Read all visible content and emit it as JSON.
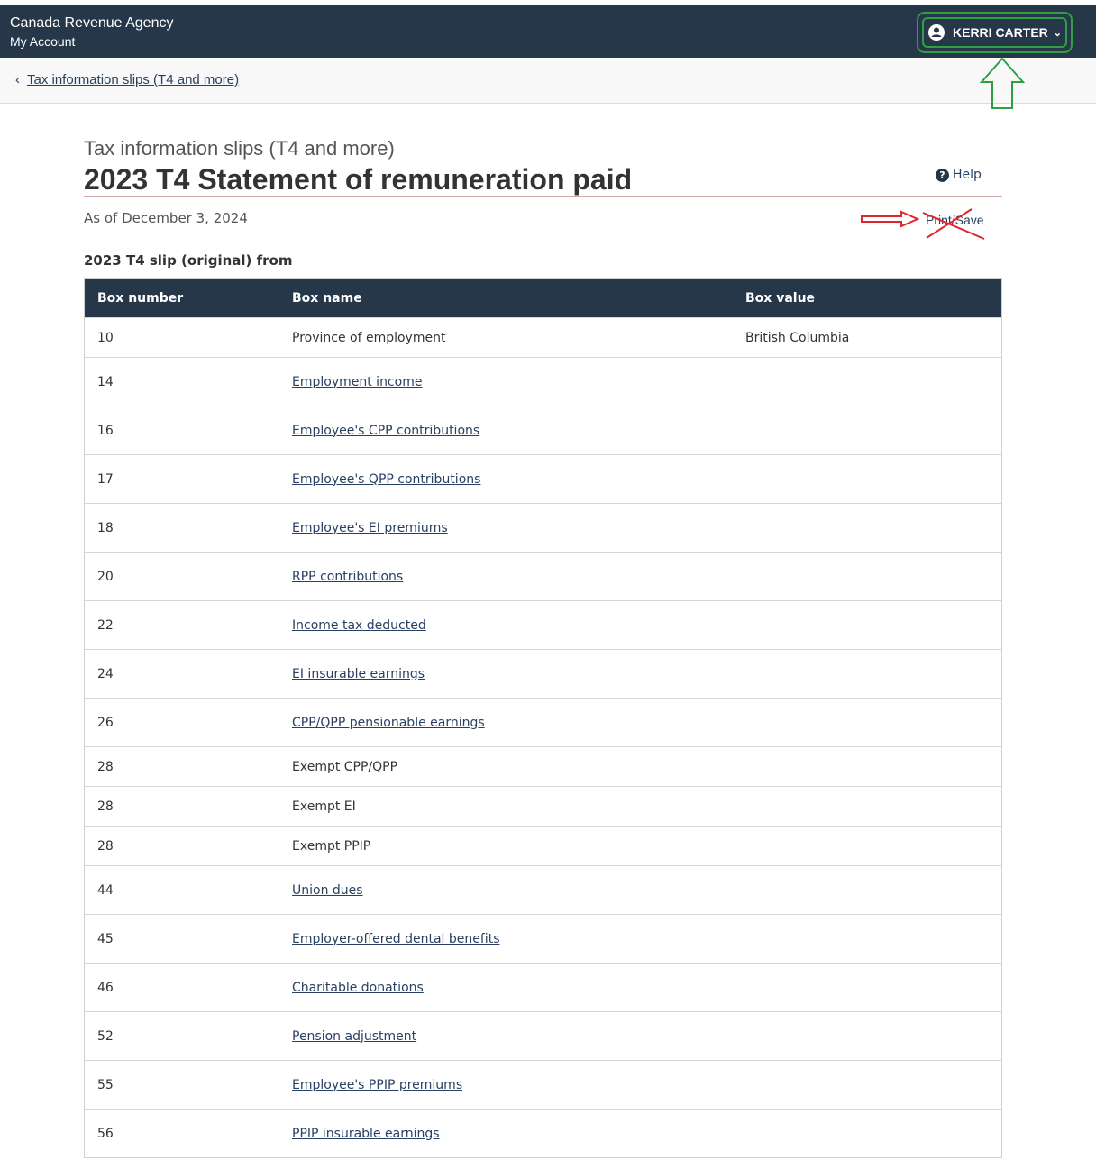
{
  "header": {
    "agency": "Canada Revenue Agency",
    "account": "My Account",
    "user_name": "KERRI CARTER"
  },
  "subnav": {
    "back_label": "Tax information slips (T4 and more)"
  },
  "page": {
    "section_title": "Tax information slips (T4 and more)",
    "title": "2023 T4 Statement of remuneration paid",
    "as_of": "As of December 3, 2024",
    "help_label": "Help",
    "print_save_label": "Print/Save",
    "slip_heading": "2023 T4 slip (original) from"
  },
  "table": {
    "headers": [
      "Box number",
      "Box name",
      "Box value"
    ],
    "rows": [
      {
        "box": "10",
        "name": "Province of employment",
        "value": "British Columbia",
        "link": false
      },
      {
        "box": "14",
        "name": "Employment income",
        "value": "",
        "link": true
      },
      {
        "box": "16",
        "name": "Employee's CPP contributions",
        "value": "",
        "link": true
      },
      {
        "box": "17",
        "name": "Employee's QPP contributions",
        "value": "",
        "link": true
      },
      {
        "box": "18",
        "name": "Employee's EI premiums",
        "value": "",
        "link": true
      },
      {
        "box": "20",
        "name": "RPP contributions",
        "value": "",
        "link": true
      },
      {
        "box": "22",
        "name": "Income tax deducted",
        "value": "",
        "link": true
      },
      {
        "box": "24",
        "name": "EI insurable earnings",
        "value": "",
        "link": true
      },
      {
        "box": "26",
        "name": "CPP/QPP pensionable earnings",
        "value": "",
        "link": true
      },
      {
        "box": "28",
        "name": "Exempt CPP/QPP",
        "value": "",
        "link": false
      },
      {
        "box": "28",
        "name": "Exempt EI",
        "value": "",
        "link": false
      },
      {
        "box": "28",
        "name": "Exempt PPIP",
        "value": "",
        "link": false
      },
      {
        "box": "44",
        "name": "Union dues",
        "value": "",
        "link": true
      },
      {
        "box": "45",
        "name": "Employer-offered dental benefits",
        "value": "",
        "link": true
      },
      {
        "box": "46",
        "name": "Charitable donations",
        "value": "",
        "link": true
      },
      {
        "box": "52",
        "name": "Pension adjustment",
        "value": "",
        "link": true
      },
      {
        "box": "55",
        "name": "Employee's PPIP premiums",
        "value": "",
        "link": true
      },
      {
        "box": "56",
        "name": "PPIP insurable earnings",
        "value": "",
        "link": true
      }
    ]
  },
  "colors": {
    "header_bg": "#26374a",
    "link": "#284162",
    "annotation_green": "#2ea042",
    "annotation_red": "#e0262b"
  }
}
